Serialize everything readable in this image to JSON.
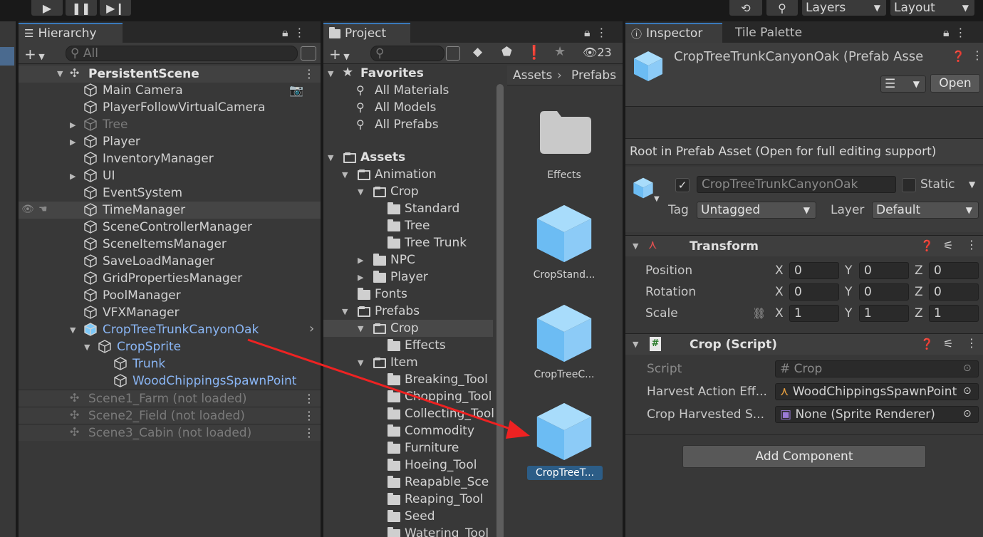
{
  "toolbar": {
    "layers_label": "Layers",
    "layout_label": "Layout"
  },
  "hierarchy": {
    "tab_label": "Hierarchy",
    "search_placeholder": "All",
    "root_scene": "PersistentScene",
    "items": [
      {
        "label": "Main Camera"
      },
      {
        "label": "PlayerFollowVirtualCamera"
      },
      {
        "label": "Tree"
      },
      {
        "label": "Player"
      },
      {
        "label": "InventoryManager"
      },
      {
        "label": "UI"
      },
      {
        "label": "EventSystem"
      },
      {
        "label": "TimeManager"
      },
      {
        "label": "SceneControllerManager"
      },
      {
        "label": "SceneItemsManager"
      },
      {
        "label": "SaveLoadManager"
      },
      {
        "label": "GridPropertiesManager"
      },
      {
        "label": "PoolManager"
      },
      {
        "label": "VFXManager"
      },
      {
        "label": "CropTreeTrunkCanyonOak"
      },
      {
        "label": "CropSprite"
      },
      {
        "label": "Trunk"
      },
      {
        "label": "WoodChippingsSpawnPoint"
      }
    ],
    "unloaded_scenes": [
      "Scene1_Farm (not loaded)",
      "Scene2_Field (not loaded)",
      "Scene3_Cabin (not loaded)"
    ]
  },
  "project": {
    "tab_label": "Project",
    "hidden_count": "23",
    "breadcrumb": [
      "Assets",
      "Prefabs"
    ],
    "favorites_label": "Favorites",
    "favorites": [
      "All Materials",
      "All Models",
      "All Prefabs"
    ],
    "tree": [
      "Assets",
      "Animation",
      "Crop",
      "Standard",
      "Tree",
      "Tree Trunk",
      "NPC",
      "Player",
      "Fonts",
      "Prefabs",
      "Crop",
      "Effects",
      "Item",
      "Breaking_Tool",
      "Chopping_Tool",
      "Collecting_Tool",
      "Commodity",
      "Furniture",
      "Hoeing_Tool",
      "Reapable_Sce",
      "Reaping_Tool",
      "Seed",
      "Watering_Tool"
    ],
    "grid_items": [
      "Effects",
      "CropStand...",
      "CropTreeC...",
      "CropTreeT..."
    ]
  },
  "inspector": {
    "tab_label": "Inspector",
    "tab2_label": "Tile Palette",
    "asset_title": "CropTreeTrunkCanyonOak (Prefab Asse",
    "open_button": "Open",
    "info_text": "Root in Prefab Asset (Open for full editing support)",
    "object_name": "CropTreeTrunkCanyonOak",
    "static_label": "Static",
    "tag_label": "Tag",
    "tag_value": "Untagged",
    "layer_label": "Layer",
    "layer_value": "Default",
    "transform": {
      "title": "Transform",
      "rows": [
        {
          "label": "Position",
          "x": "0",
          "y": "0",
          "z": "0"
        },
        {
          "label": "Rotation",
          "x": "0",
          "y": "0",
          "z": "0"
        },
        {
          "label": "Scale",
          "x": "1",
          "y": "1",
          "z": "1"
        }
      ],
      "axes": [
        "X",
        "Y",
        "Z"
      ]
    },
    "crop_script": {
      "title": "Crop (Script)",
      "script_label": "Script",
      "script_value": "Crop",
      "harvest_label": "Harvest Action Eff...",
      "harvest_value": "WoodChippingsSpawnPoint",
      "harvested_label": "Crop Harvested S...",
      "harvested_value": "None (Sprite Renderer)"
    },
    "add_component": "Add Component"
  },
  "colors": {
    "selection_blue": "#8ab6f5",
    "prefab_cube": "#7cc8f8",
    "annotation_arrow": "#ee2222"
  }
}
